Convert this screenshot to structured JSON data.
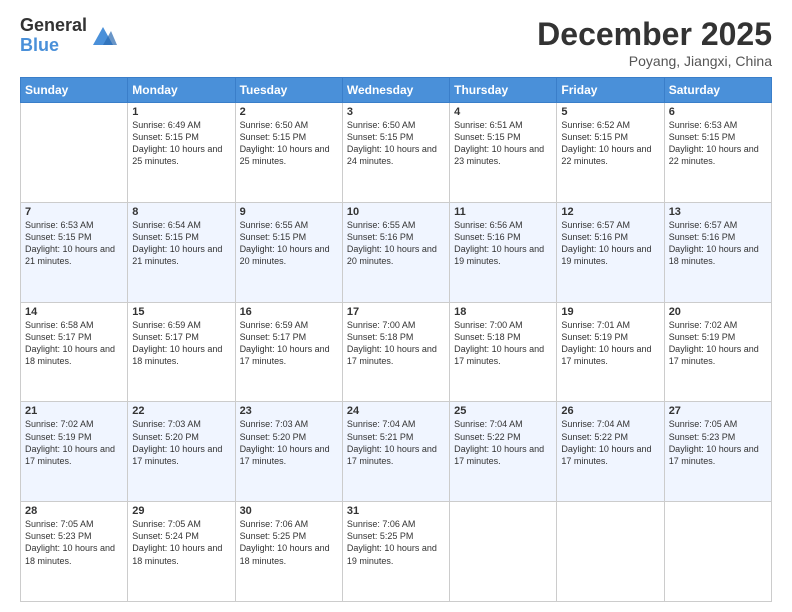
{
  "logo": {
    "general": "General",
    "blue": "Blue"
  },
  "header": {
    "month": "December 2025",
    "location": "Poyang, Jiangxi, China"
  },
  "weekdays": [
    "Sunday",
    "Monday",
    "Tuesday",
    "Wednesday",
    "Thursday",
    "Friday",
    "Saturday"
  ],
  "weeks": [
    [
      {
        "day": "",
        "sunrise": "",
        "sunset": "",
        "daylight": ""
      },
      {
        "day": "1",
        "sunrise": "Sunrise: 6:49 AM",
        "sunset": "Sunset: 5:15 PM",
        "daylight": "Daylight: 10 hours and 25 minutes."
      },
      {
        "day": "2",
        "sunrise": "Sunrise: 6:50 AM",
        "sunset": "Sunset: 5:15 PM",
        "daylight": "Daylight: 10 hours and 25 minutes."
      },
      {
        "day": "3",
        "sunrise": "Sunrise: 6:50 AM",
        "sunset": "Sunset: 5:15 PM",
        "daylight": "Daylight: 10 hours and 24 minutes."
      },
      {
        "day": "4",
        "sunrise": "Sunrise: 6:51 AM",
        "sunset": "Sunset: 5:15 PM",
        "daylight": "Daylight: 10 hours and 23 minutes."
      },
      {
        "day": "5",
        "sunrise": "Sunrise: 6:52 AM",
        "sunset": "Sunset: 5:15 PM",
        "daylight": "Daylight: 10 hours and 22 minutes."
      },
      {
        "day": "6",
        "sunrise": "Sunrise: 6:53 AM",
        "sunset": "Sunset: 5:15 PM",
        "daylight": "Daylight: 10 hours and 22 minutes."
      }
    ],
    [
      {
        "day": "7",
        "sunrise": "Sunrise: 6:53 AM",
        "sunset": "Sunset: 5:15 PM",
        "daylight": "Daylight: 10 hours and 21 minutes."
      },
      {
        "day": "8",
        "sunrise": "Sunrise: 6:54 AM",
        "sunset": "Sunset: 5:15 PM",
        "daylight": "Daylight: 10 hours and 21 minutes."
      },
      {
        "day": "9",
        "sunrise": "Sunrise: 6:55 AM",
        "sunset": "Sunset: 5:15 PM",
        "daylight": "Daylight: 10 hours and 20 minutes."
      },
      {
        "day": "10",
        "sunrise": "Sunrise: 6:55 AM",
        "sunset": "Sunset: 5:16 PM",
        "daylight": "Daylight: 10 hours and 20 minutes."
      },
      {
        "day": "11",
        "sunrise": "Sunrise: 6:56 AM",
        "sunset": "Sunset: 5:16 PM",
        "daylight": "Daylight: 10 hours and 19 minutes."
      },
      {
        "day": "12",
        "sunrise": "Sunrise: 6:57 AM",
        "sunset": "Sunset: 5:16 PM",
        "daylight": "Daylight: 10 hours and 19 minutes."
      },
      {
        "day": "13",
        "sunrise": "Sunrise: 6:57 AM",
        "sunset": "Sunset: 5:16 PM",
        "daylight": "Daylight: 10 hours and 18 minutes."
      }
    ],
    [
      {
        "day": "14",
        "sunrise": "Sunrise: 6:58 AM",
        "sunset": "Sunset: 5:17 PM",
        "daylight": "Daylight: 10 hours and 18 minutes."
      },
      {
        "day": "15",
        "sunrise": "Sunrise: 6:59 AM",
        "sunset": "Sunset: 5:17 PM",
        "daylight": "Daylight: 10 hours and 18 minutes."
      },
      {
        "day": "16",
        "sunrise": "Sunrise: 6:59 AM",
        "sunset": "Sunset: 5:17 PM",
        "daylight": "Daylight: 10 hours and 17 minutes."
      },
      {
        "day": "17",
        "sunrise": "Sunrise: 7:00 AM",
        "sunset": "Sunset: 5:18 PM",
        "daylight": "Daylight: 10 hours and 17 minutes."
      },
      {
        "day": "18",
        "sunrise": "Sunrise: 7:00 AM",
        "sunset": "Sunset: 5:18 PM",
        "daylight": "Daylight: 10 hours and 17 minutes."
      },
      {
        "day": "19",
        "sunrise": "Sunrise: 7:01 AM",
        "sunset": "Sunset: 5:19 PM",
        "daylight": "Daylight: 10 hours and 17 minutes."
      },
      {
        "day": "20",
        "sunrise": "Sunrise: 7:02 AM",
        "sunset": "Sunset: 5:19 PM",
        "daylight": "Daylight: 10 hours and 17 minutes."
      }
    ],
    [
      {
        "day": "21",
        "sunrise": "Sunrise: 7:02 AM",
        "sunset": "Sunset: 5:19 PM",
        "daylight": "Daylight: 10 hours and 17 minutes."
      },
      {
        "day": "22",
        "sunrise": "Sunrise: 7:03 AM",
        "sunset": "Sunset: 5:20 PM",
        "daylight": "Daylight: 10 hours and 17 minutes."
      },
      {
        "day": "23",
        "sunrise": "Sunrise: 7:03 AM",
        "sunset": "Sunset: 5:20 PM",
        "daylight": "Daylight: 10 hours and 17 minutes."
      },
      {
        "day": "24",
        "sunrise": "Sunrise: 7:04 AM",
        "sunset": "Sunset: 5:21 PM",
        "daylight": "Daylight: 10 hours and 17 minutes."
      },
      {
        "day": "25",
        "sunrise": "Sunrise: 7:04 AM",
        "sunset": "Sunset: 5:22 PM",
        "daylight": "Daylight: 10 hours and 17 minutes."
      },
      {
        "day": "26",
        "sunrise": "Sunrise: 7:04 AM",
        "sunset": "Sunset: 5:22 PM",
        "daylight": "Daylight: 10 hours and 17 minutes."
      },
      {
        "day": "27",
        "sunrise": "Sunrise: 7:05 AM",
        "sunset": "Sunset: 5:23 PM",
        "daylight": "Daylight: 10 hours and 17 minutes."
      }
    ],
    [
      {
        "day": "28",
        "sunrise": "Sunrise: 7:05 AM",
        "sunset": "Sunset: 5:23 PM",
        "daylight": "Daylight: 10 hours and 18 minutes."
      },
      {
        "day": "29",
        "sunrise": "Sunrise: 7:05 AM",
        "sunset": "Sunset: 5:24 PM",
        "daylight": "Daylight: 10 hours and 18 minutes."
      },
      {
        "day": "30",
        "sunrise": "Sunrise: 7:06 AM",
        "sunset": "Sunset: 5:25 PM",
        "daylight": "Daylight: 10 hours and 18 minutes."
      },
      {
        "day": "31",
        "sunrise": "Sunrise: 7:06 AM",
        "sunset": "Sunset: 5:25 PM",
        "daylight": "Daylight: 10 hours and 19 minutes."
      },
      {
        "day": "",
        "sunrise": "",
        "sunset": "",
        "daylight": ""
      },
      {
        "day": "",
        "sunrise": "",
        "sunset": "",
        "daylight": ""
      },
      {
        "day": "",
        "sunrise": "",
        "sunset": "",
        "daylight": ""
      }
    ]
  ]
}
